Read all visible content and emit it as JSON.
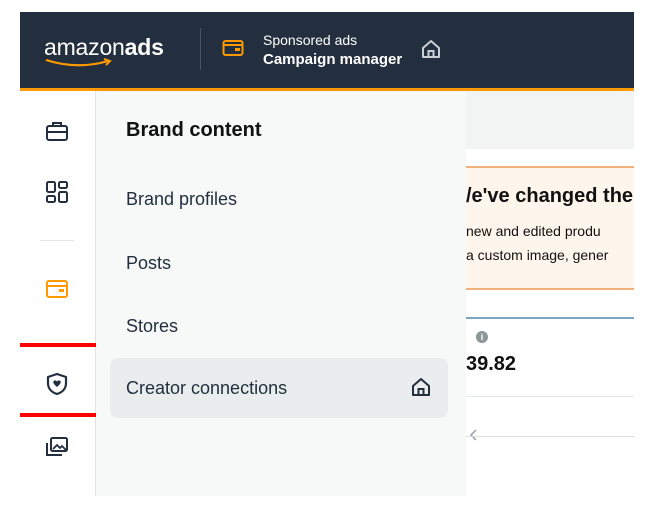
{
  "header": {
    "logo_regular": "amazon",
    "logo_bold": "ads",
    "product_line1": "Sponsored ads",
    "product_line2": "Campaign manager",
    "colors": {
      "bar": "#232f3e",
      "accent": "#ff9900"
    },
    "icons": [
      "wallet-icon",
      "home-icon"
    ]
  },
  "rail": {
    "icons": [
      "briefcase-icon",
      "dashboard-grid-icon",
      "wallet-icon",
      "shield-icon",
      "media-gallery-icon"
    ],
    "highlighted": "shield-icon",
    "highlight_color": "#ff0000"
  },
  "panel": {
    "title": "Brand content",
    "items": [
      {
        "label": "Brand profiles"
      },
      {
        "label": "Posts"
      },
      {
        "label": "Stores"
      },
      {
        "label": "Creator connections",
        "selected": true,
        "icon": "home-icon"
      }
    ]
  },
  "background_page": {
    "banner_title": "/e've changed the",
    "banner_line1": "new and edited produ",
    "banner_line2": "a custom image, gener",
    "metric_value": "39.82"
  }
}
